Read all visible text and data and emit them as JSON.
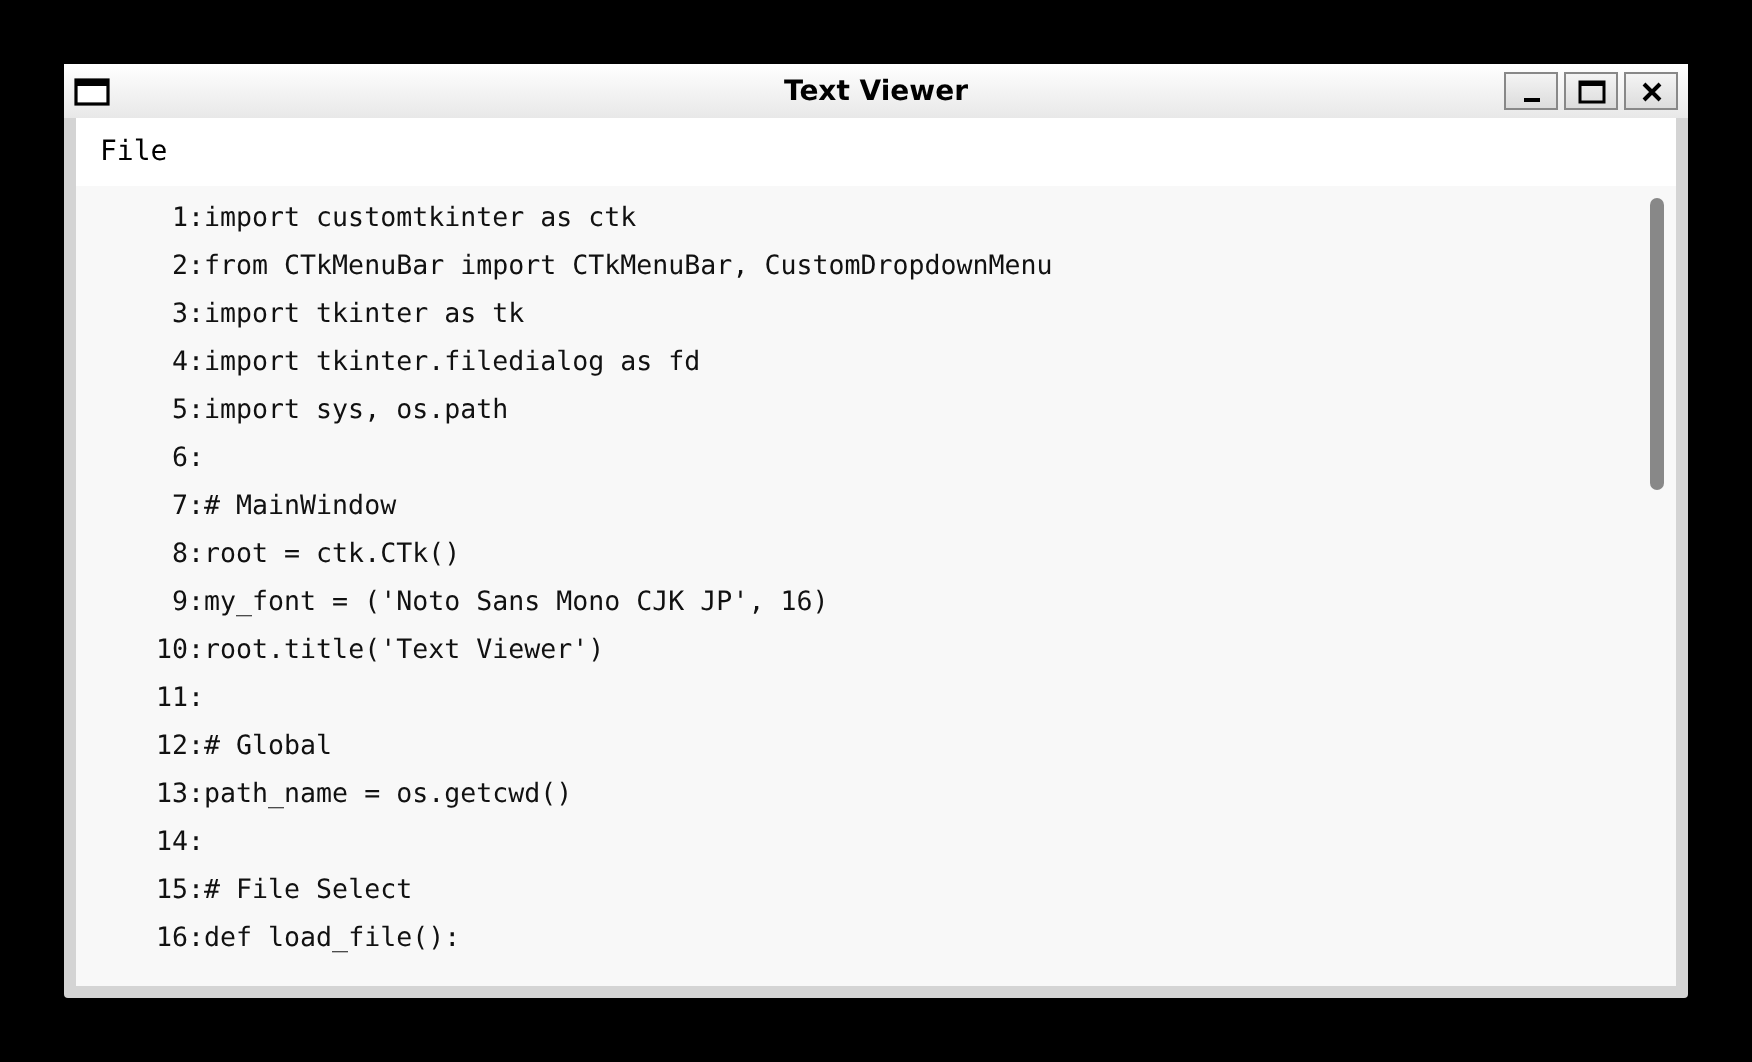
{
  "window": {
    "title": "Text Viewer"
  },
  "menu": [
    {
      "label": "File"
    }
  ],
  "lines": [
    "1:import customtkinter as ctk",
    "2:from CTkMenuBar import CTkMenuBar, CustomDropdownMenu",
    "3:import tkinter as tk",
    "4:import tkinter.filedialog as fd",
    "5:import sys, os.path",
    "6:",
    "7:# MainWindow",
    "8:root = ctk.CTk()",
    "9:my_font = ('Noto Sans Mono CJK JP', 16)",
    "10:root.title('Text Viewer')",
    "11:",
    "12:# Global",
    "13:path_name = os.getcwd()",
    "14:",
    "15:# File Select",
    "16:def load_file():"
  ]
}
